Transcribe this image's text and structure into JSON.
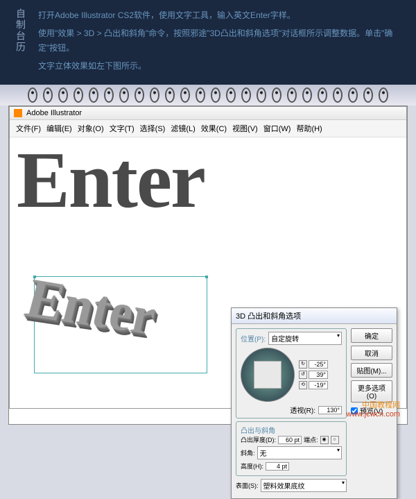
{
  "top": {
    "title": "自制台历",
    "line1": "打开Adobe Illustrator CS2软件，使用文字工具，输入英文Enter字样。",
    "line2": "使用\"效果 > 3D > 凸出和斜角\"命令，按照邪途\"3D凸出和斜角选项\"对话框所示调整数据。单击\"确定\"按钮。",
    "line3": "文字立体效果如左下图所示。"
  },
  "ai": {
    "title": "Adobe Illustrator",
    "menu": [
      "文件(F)",
      "编辑(E)",
      "对象(O)",
      "文字(T)",
      "选择(S)",
      "滤镜(L)",
      "效果(C)",
      "视图(V)",
      "窗口(W)",
      "帮助(H)"
    ]
  },
  "word": "Enter",
  "dialog": {
    "title": "3D 凸出和斜角选项",
    "position_label": "位置(P):",
    "position_value": "自定旋转",
    "angles": {
      "x": "-25°",
      "y": "39°",
      "z": "-19°"
    },
    "perspective_label": "透视(R):",
    "perspective_value": "130°",
    "bevel_group": "凸出与斜角",
    "depth_label": "凸出厚度(D):",
    "depth_value": "60 pt",
    "cap_label": "端点:",
    "bev_label": "斜角:",
    "bev_value": "无",
    "height_label": "高度(H):",
    "height_value": "4 pt",
    "surface_label": "表面(S):",
    "surface_value": "塑料效果底纹",
    "buttons": {
      "ok": "确定",
      "cancel": "取消",
      "map": "贴图(M)...",
      "more": "更多选项(O)",
      "preview": "预览(V)"
    }
  },
  "watermark": {
    "l1": "中国教程网",
    "l2": "www.jcwcn.com"
  }
}
